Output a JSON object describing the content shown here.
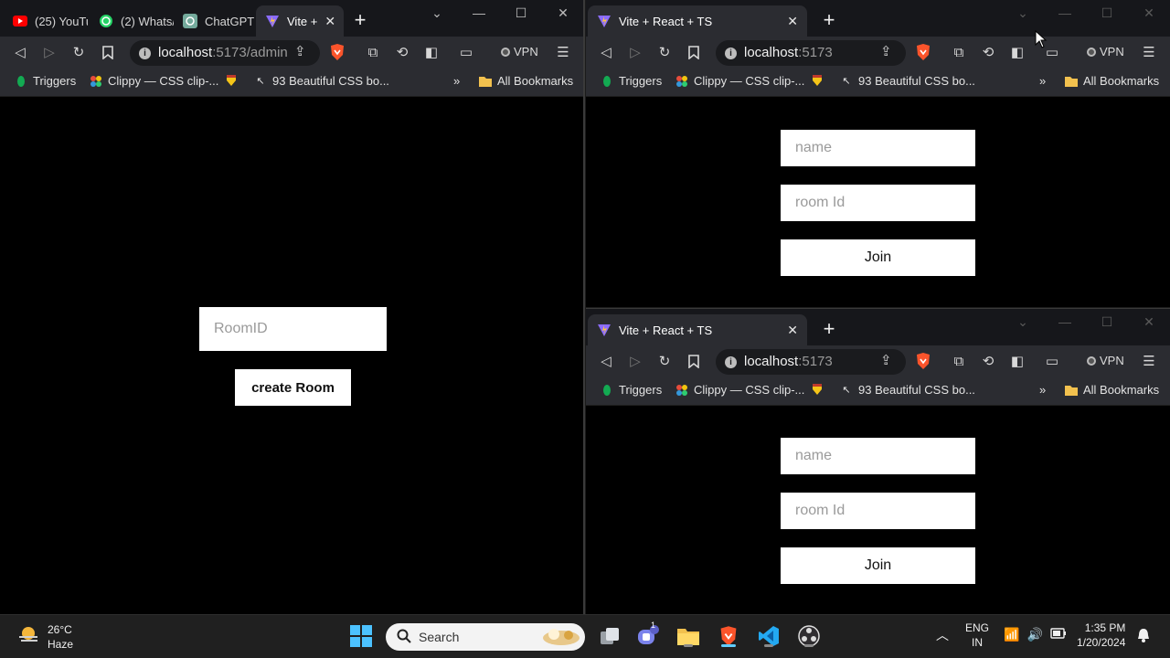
{
  "left_window": {
    "tabs": [
      {
        "label": "(25) YouTu",
        "icon": "youtube-icon"
      },
      {
        "label": "(2) Whats/",
        "icon": "whatsapp-icon"
      },
      {
        "label": "ChatGPT",
        "icon": "chatgpt-icon"
      },
      {
        "label": "Vite +",
        "icon": "vite-icon",
        "active": true
      }
    ],
    "url_host": "localhost",
    "url_path": ":5173/admin",
    "room_input_placeholder": "RoomID",
    "create_button_label": "create Room"
  },
  "right_windows": [
    {
      "tab_label": "Vite + React + TS",
      "url_host": "localhost",
      "url_path": ":5173",
      "name_placeholder": "name",
      "room_placeholder": "room Id",
      "join_label": "Join"
    },
    {
      "tab_label": "Vite + React + TS",
      "url_host": "localhost",
      "url_path": ":5173",
      "name_placeholder": "name",
      "room_placeholder": "room Id",
      "join_label": "Join"
    }
  ],
  "bookmarks": {
    "items": [
      "Triggers",
      "Clippy — CSS clip-...",
      "",
      "93 Beautiful CSS bo..."
    ],
    "overflow": "»",
    "all_bookmarks": "All Bookmarks"
  },
  "vpn_label": "VPN",
  "taskbar": {
    "temperature": "26°C",
    "condition": "Haze",
    "search_label": "Search",
    "teams_badge": "1",
    "lang": "ENG",
    "region": "IN",
    "time": "1:35 PM",
    "date": "1/20/2024"
  },
  "colors": {
    "accent": "#60cdff",
    "brave": "#fb542b",
    "youtube": "#ff0000",
    "whatsapp": "#25d366"
  }
}
